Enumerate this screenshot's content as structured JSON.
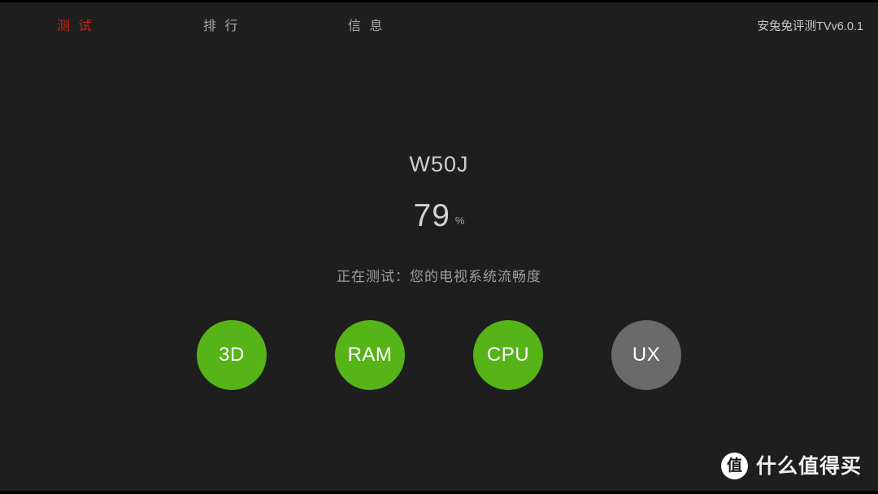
{
  "app": {
    "background_color": "#1e1e1e",
    "accent_color": "#cc2316",
    "done_color": "#56b318",
    "pending_color": "#6a6a6a",
    "version_label": "安兔兔评测TVv6.0.1"
  },
  "navigation": {
    "tabs": [
      {
        "label": "测 试",
        "name": "tab-test",
        "active": true
      },
      {
        "label": "排 行",
        "name": "tab-rank",
        "active": false
      },
      {
        "label": "信 息",
        "name": "tab-info",
        "active": false
      }
    ]
  },
  "main": {
    "device_name": "W50J",
    "progress_value": "79",
    "progress_unit": "%",
    "status_text": "正在测试：您的电视系统流畅度",
    "test_items": [
      {
        "label": "3D",
        "state": "done"
      },
      {
        "label": "RAM",
        "state": "done"
      },
      {
        "label": "CPU",
        "state": "done"
      },
      {
        "label": "UX",
        "state": "pending"
      }
    ]
  },
  "watermark": {
    "logo_glyph": "值",
    "text": "什么值得买"
  }
}
